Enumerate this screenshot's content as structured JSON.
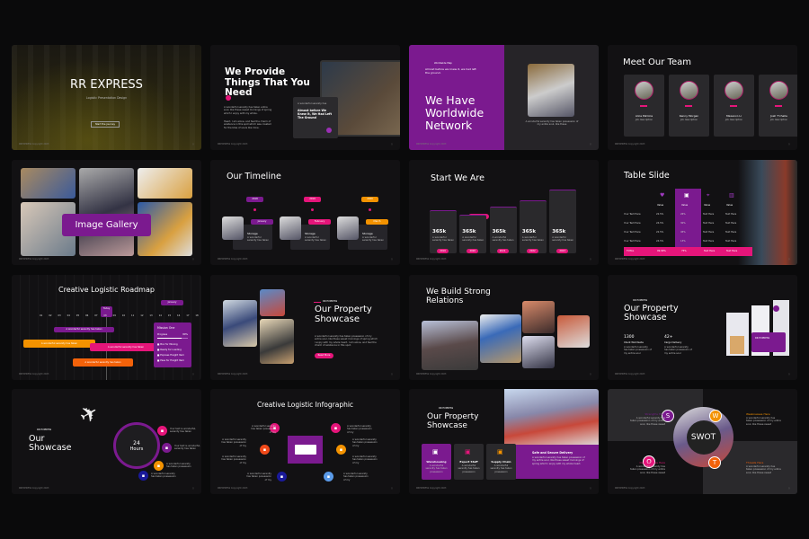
{
  "footer": "RREXPRESS Copyright 2023",
  "colors": {
    "purple": "#7b1a8f",
    "pink": "#e5157a",
    "orange": "#f39200",
    "dark": "#121113"
  },
  "s1": {
    "title": "RR EXPRESS",
    "subtitle": "Logistic Presentation Design",
    "button": "Start the journey"
  },
  "s2": {
    "title": "We Provide Things That You Need",
    "body1": "A wonderful serenity has taken entire soul, like these sweet mornings of spring which I enjoy with my whole.",
    "body2": "Heart. I am alone, and feel the charm of existence in this spot which was created for the bliss of souls like mine.",
    "card_label": "A wonderful serenity has",
    "card_text": "Almost before We Knew It, We Had Left The Ground"
  },
  "s3": {
    "kicker": "Worldwide Map",
    "intro": "Almost before we knew it, we had left the ground.",
    "title": "We Have Worldwide Network",
    "caption": "A wonderful serenity has taken possession of my entire soul, like these"
  },
  "s4": {
    "title": "Meet Our Team",
    "members": [
      {
        "name": "Alice Patricia",
        "role": "Job description"
      },
      {
        "name": "Kenny Morgan",
        "role": "Job description"
      },
      {
        "name": "Maxenco Li",
        "role": "Job description"
      },
      {
        "name": "Josh T'challa",
        "role": "Job description"
      }
    ]
  },
  "s5": {
    "title": "Image Gallery"
  },
  "s6": {
    "title": "Our Timeline",
    "items": [
      {
        "year": "2018",
        "month": "January",
        "label": "Storage",
        "text": "A wonderful serenity has taken"
      },
      {
        "year": "2019",
        "month": "February",
        "label": "Storage",
        "text": "A wonderful serenity has taken"
      },
      {
        "year": "2020",
        "month": "March",
        "label": "Storage",
        "text": "A wonderful serenity has taken"
      }
    ]
  },
  "s7": {
    "title": "Start We Are",
    "highlight": "Highlighted",
    "bars": [
      {
        "value": "365k",
        "text": "A wonderful serenity has taken",
        "year": "2019",
        "level": 0.55
      },
      {
        "value": "365k",
        "text": "A wonderful serenity has taken",
        "year": "2020",
        "level": 0.45
      },
      {
        "value": "365k",
        "text": "A wonderful serenity has taken",
        "year": "2021",
        "level": 0.62
      },
      {
        "value": "365k",
        "text": "A wonderful serenity has taken",
        "year": "2022",
        "level": 0.76
      },
      {
        "value": "365k",
        "text": "A wonderful serenity has taken",
        "year": "2023",
        "level": 1
      }
    ]
  },
  "s8": {
    "title": "Table Slide",
    "headers": [
      "Value",
      "Value",
      "Value",
      "Value"
    ],
    "rows": [
      [
        "Your Text Here",
        "22.5%",
        "26%",
        "Text Here",
        "Text Here"
      ],
      [
        "Your Text Here",
        "24.5%",
        "30%",
        "Text Here",
        "Text Here"
      ],
      [
        "Your Text Here",
        "22.5%",
        "45%",
        "Text Here",
        "Text Here"
      ],
      [
        "Your Text Here",
        "24.5%",
        "13%",
        "Text Here",
        "Text Here"
      ]
    ],
    "total": [
      "TOTAL",
      "99.99%",
      "75%",
      "Text Here",
      "Text Here"
    ]
  },
  "s9": {
    "title": "Creative Logistic Roadmap",
    "month": "January",
    "today": "Today",
    "days": [
      "01",
      "02",
      "03",
      "04",
      "05",
      "06",
      "07",
      "08",
      "09",
      "10",
      "11",
      "12",
      "13",
      "14",
      "15",
      "16",
      "17",
      "18",
      "19"
    ],
    "tasks": [
      "A wonderful serenity has taken",
      "A wonderful serenity has taken",
      "A wonderful serenity has taken",
      "A wonderful serenity has taken"
    ],
    "mission": {
      "title": "Mission One",
      "progress_label": "Progress",
      "progress": 0.8,
      "progress_text": "80%",
      "items": [
        "Box for Moving",
        "Ready for Loading",
        "Express Freight Item",
        "Pass for Freight Item"
      ]
    }
  },
  "s10": {
    "kicker": "RR EXPRESS",
    "title": "Our Property Showcase",
    "body": "A wonderful serenity has taken possession of my entire soul, like these sweet mornings of spring which I enjoy with my whole heart. I am alone, and feel the charm of existence in this spot.",
    "button": "Read More"
  },
  "s11": {
    "title": "We Build Strong Relations"
  },
  "s12": {
    "kicker": "RR EXPRESS",
    "title": "Our Property Showcase",
    "stats": [
      {
        "value": "1300",
        "label": "Client Worldwide",
        "text": "A wonderful serenity has taken possession of my entire soul"
      },
      {
        "value": "42+",
        "label": "Cargo Delivery",
        "text": "A wonderful serenity has taken possession of my entire soul"
      }
    ],
    "truck_label": "RR EXPRESS"
  },
  "s13": {
    "kicker": "RR EXPRESS",
    "title": "Our Showcase",
    "center_value": "24",
    "center_label": "Hours",
    "items": [
      "Your text is wonderful, serenity has taken",
      "Your text is wonderful, serenity has taken",
      "A wonderful serenity has taken possession",
      "A wonderful serenity has taken possession"
    ]
  },
  "s14": {
    "title": "Creative Logistic Infographic",
    "left": [
      "A wonderful serenity has taken possession of my",
      "A wonderful serenity has taken possession of my",
      "A wonderful serenity has taken possession of my",
      "A wonderful serenity has taken possession of my"
    ],
    "right": [
      "A wonderful serenity has taken possession of my",
      "A wonderful serenity has taken possession of my",
      "A wonderful serenity has taken possession of my",
      "A wonderful serenity has taken possession of my"
    ]
  },
  "s15": {
    "kicker": "RR EXPRESS",
    "title": "Our Property Showcase",
    "services": [
      {
        "label": "Warehousing",
        "text": "A wonderful serenity has taken possession"
      },
      {
        "label": "Expert Staff",
        "text": "A wonderful serenity has taken possession"
      },
      {
        "label": "Supply Chain",
        "text": "A wonderful serenity has taken possession"
      }
    ],
    "banner_title": "Safe and Secure Delivery",
    "banner_text": "A wonderful serenity has taken possession of my entire soul, like these sweet mornings of spring which I enjoy with my whole heart."
  },
  "s16": {
    "center": "SWOT",
    "quadrants": [
      {
        "letter": "S",
        "title": "Strengths Here",
        "text": "A wonderful serenity has taken possession of my entire soul, like these sweet"
      },
      {
        "letter": "W",
        "title": "Weaknesses Here",
        "text": "A wonderful serenity has taken possession of my entire soul, like these sweet"
      },
      {
        "letter": "O",
        "title": "Opportunities Here",
        "text": "A wonderful serenity has taken possession of my entire soul, like these sweet"
      },
      {
        "letter": "T",
        "title": "Threats Here",
        "text": "A wonderful serenity has taken possession of my entire soul, like these sweet"
      }
    ]
  }
}
